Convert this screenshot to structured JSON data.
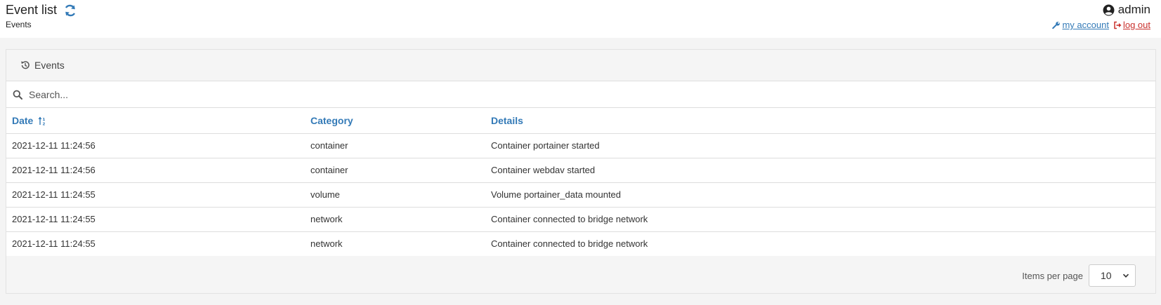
{
  "header": {
    "title": "Event list",
    "breadcrumb": "Events"
  },
  "user": {
    "name": "admin",
    "my_account": "my account",
    "log_out": "log out"
  },
  "widget": {
    "title": "Events",
    "search_placeholder": "Search...",
    "columns": [
      "Date",
      "Category",
      "Details"
    ],
    "rows": [
      {
        "date": "2021-12-11 11:24:56",
        "category": "container",
        "details": "Container portainer started"
      },
      {
        "date": "2021-12-11 11:24:56",
        "category": "container",
        "details": "Container webdav started"
      },
      {
        "date": "2021-12-11 11:24:55",
        "category": "volume",
        "details": "Volume portainer_data mounted"
      },
      {
        "date": "2021-12-11 11:24:55",
        "category": "network",
        "details": "Container connected to bridge network"
      },
      {
        "date": "2021-12-11 11:24:55",
        "category": "network",
        "details": "Container connected to bridge network"
      }
    ],
    "items_per_page_label": "Items per page",
    "items_per_page_value": "10"
  },
  "colors": {
    "link": "#337ab7",
    "logout": "#c9302c",
    "header_bg": "#ffffff",
    "page_bg": "#f4f4f4"
  },
  "icons": [
    "refresh-icon",
    "user-circle-icon",
    "wrench-icon",
    "sign-out-icon",
    "history-icon",
    "search-icon",
    "sort-ascending-icon",
    "chevron-down-icon"
  ]
}
